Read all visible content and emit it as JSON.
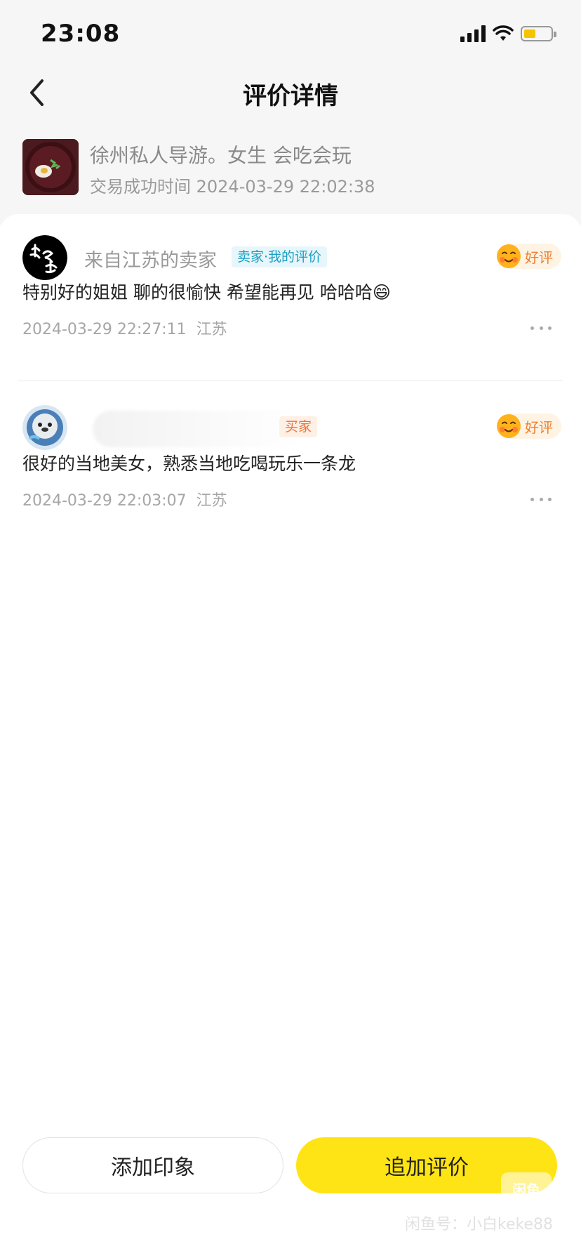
{
  "status_bar": {
    "time": "23:08",
    "battery_color": "#f5c400"
  },
  "header": {
    "title": "评价详情",
    "back_icon": "chevron-left-icon"
  },
  "product": {
    "title": "徐州私人导游。女生 会吃会玩",
    "trade_time": "交易成功时间 2024-03-29 22:02:38"
  },
  "reviews": [
    {
      "name": "来自江苏的卖家",
      "role": "卖家·我的评价",
      "rating": "好评",
      "text": "特别好的姐姐 聊的很愉快 希望能再见 哈哈哈😄",
      "time": "2024-03-29 22:27:11",
      "location": "江苏"
    },
    {
      "name": "",
      "role": "买家",
      "rating": "好评",
      "text": "很好的当地美女，熟悉当地吃喝玩乐一条龙",
      "time": "2024-03-29 22:03:07",
      "location": "江苏"
    }
  ],
  "actions": {
    "add_impression": "添加印象",
    "add_review": "追加评价"
  },
  "watermark": {
    "logo": "闲鱼",
    "text": "闲鱼号：小白keke88"
  },
  "colors": {
    "primary": "#ffe415",
    "good_review": "#f07f2d",
    "seller_tag": "#1aa0c4",
    "buyer_tag": "#e8743b"
  }
}
